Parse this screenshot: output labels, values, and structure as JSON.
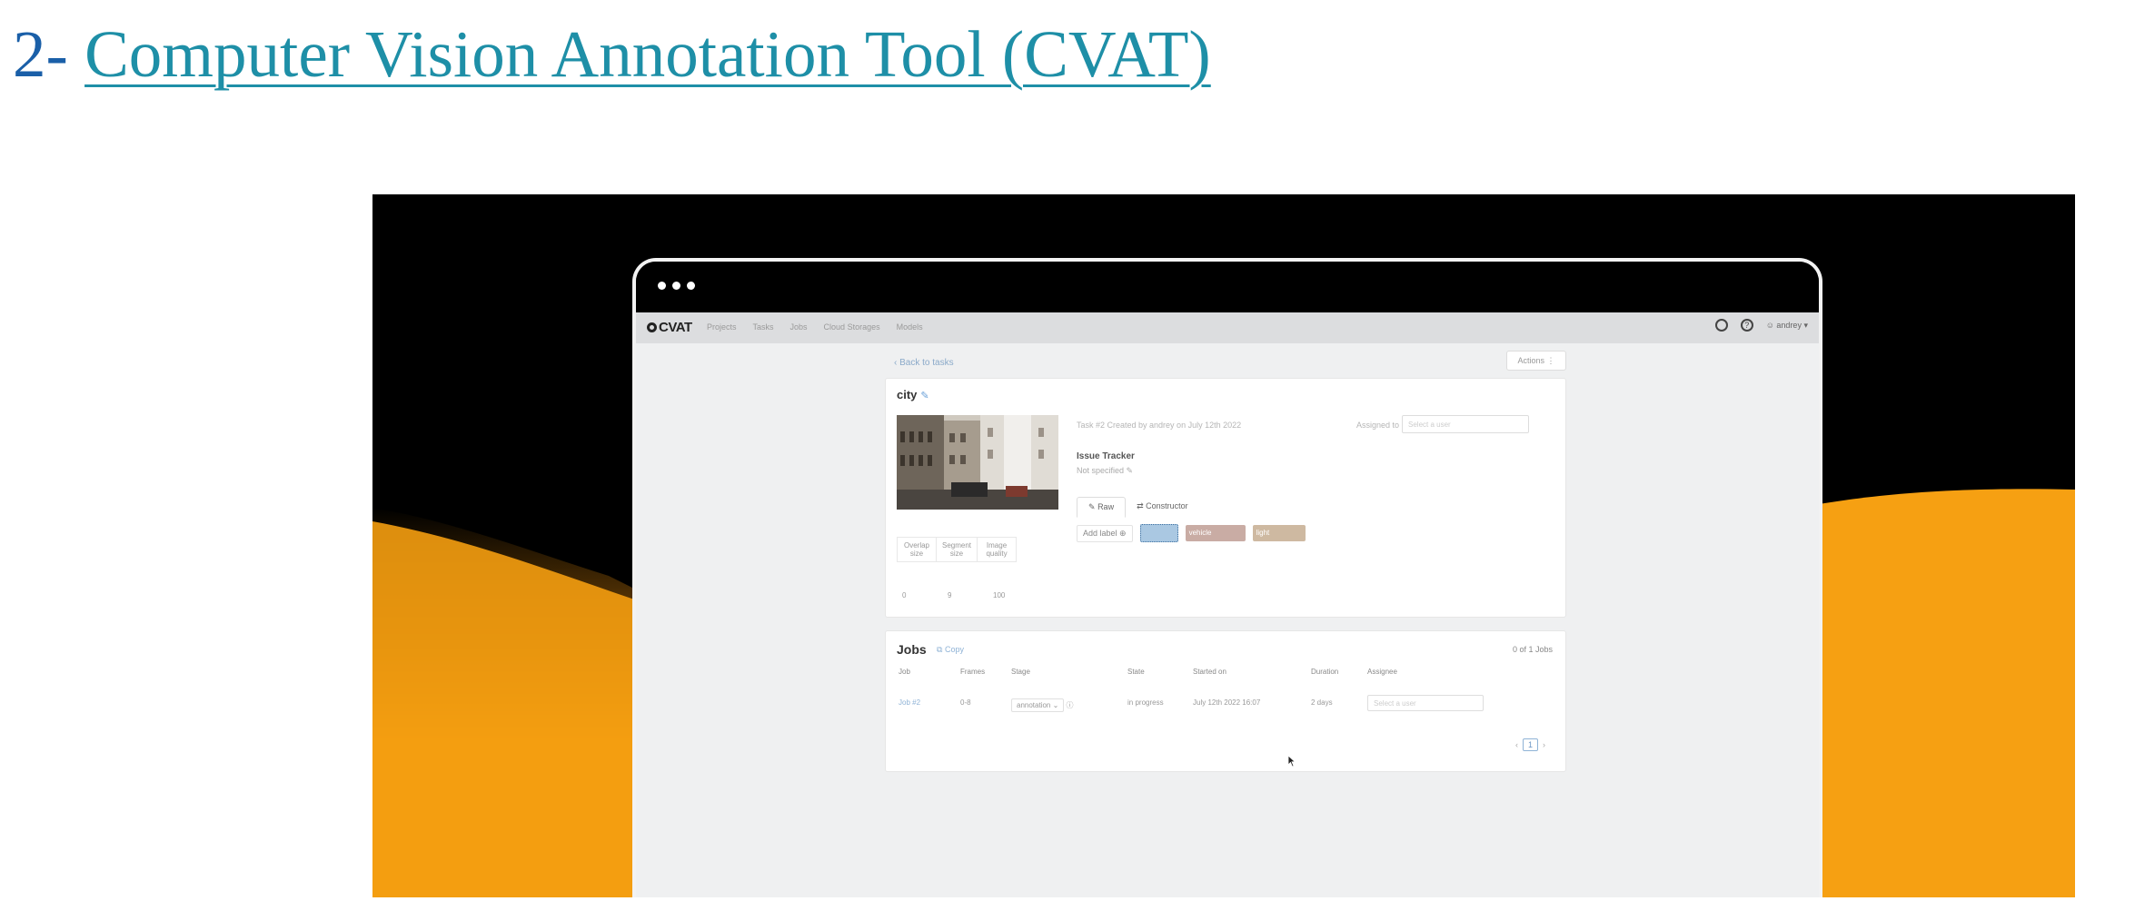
{
  "heading": {
    "number": "2- ",
    "link_text": "Computer Vision Annotation Tool (CVAT)"
  },
  "navbar": {
    "logo": "CVAT",
    "links": [
      "Projects",
      "Tasks",
      "Jobs",
      "Cloud Storages",
      "Models"
    ],
    "user": "andrey"
  },
  "task_page": {
    "back_link": "Back to tasks",
    "actions_label": "Actions",
    "task_name": "city",
    "task_info": "Task #2 Created by andrey on July 12th 2022",
    "assigned_label": "Assigned to",
    "assigned_placeholder": "Select a user",
    "tracker_title": "Issue Tracker",
    "tracker_value": "Not specified",
    "tabs": [
      "Raw",
      "Constructor"
    ],
    "add_label": "Add label",
    "labels": [
      "",
      "vehicle",
      "light"
    ],
    "params": {
      "headers": [
        "Overlap size",
        "Segment size",
        "Image quality"
      ],
      "values": [
        "0",
        "9",
        "100"
      ]
    }
  },
  "jobs": {
    "title": "Jobs",
    "copy_label": "Copy",
    "count": "0 of 1 Jobs",
    "columns": [
      "Job",
      "Frames",
      "Stage",
      "State",
      "Started on",
      "Duration",
      "Assignee"
    ],
    "rows": [
      {
        "job": "Job #2",
        "frames": "0-8",
        "stage": "annotation",
        "state": "in progress",
        "started": "July 12th 2022 16:07",
        "duration": "2 days",
        "assignee": "Select a user"
      }
    ],
    "page": "1"
  }
}
